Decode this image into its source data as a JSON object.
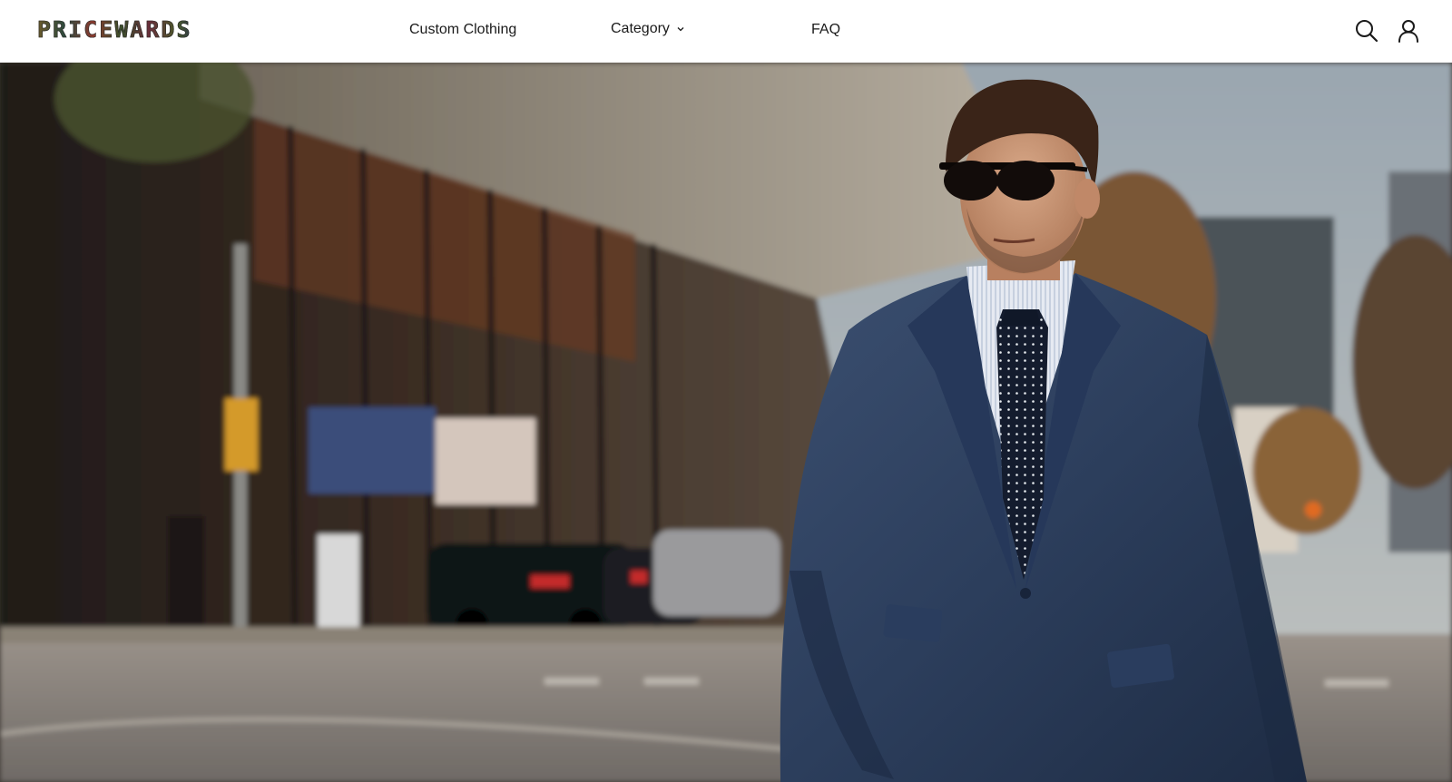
{
  "brand": {
    "logo_text": "PRICEWARDS"
  },
  "nav": {
    "items": [
      {
        "label": "Custom Clothing"
      },
      {
        "label": "Category",
        "has_dropdown": true
      },
      {
        "label": "FAQ"
      }
    ]
  },
  "header_icons": {
    "search": "search-icon",
    "account": "user-icon"
  },
  "hero": {
    "image_subject": "man in navy suit with polka dot tie and sunglasses on city street"
  },
  "colors": {
    "header_bg": "#ffffff",
    "nav_text": "#1a1a1a",
    "suit_navy": "#2c3e5c"
  }
}
